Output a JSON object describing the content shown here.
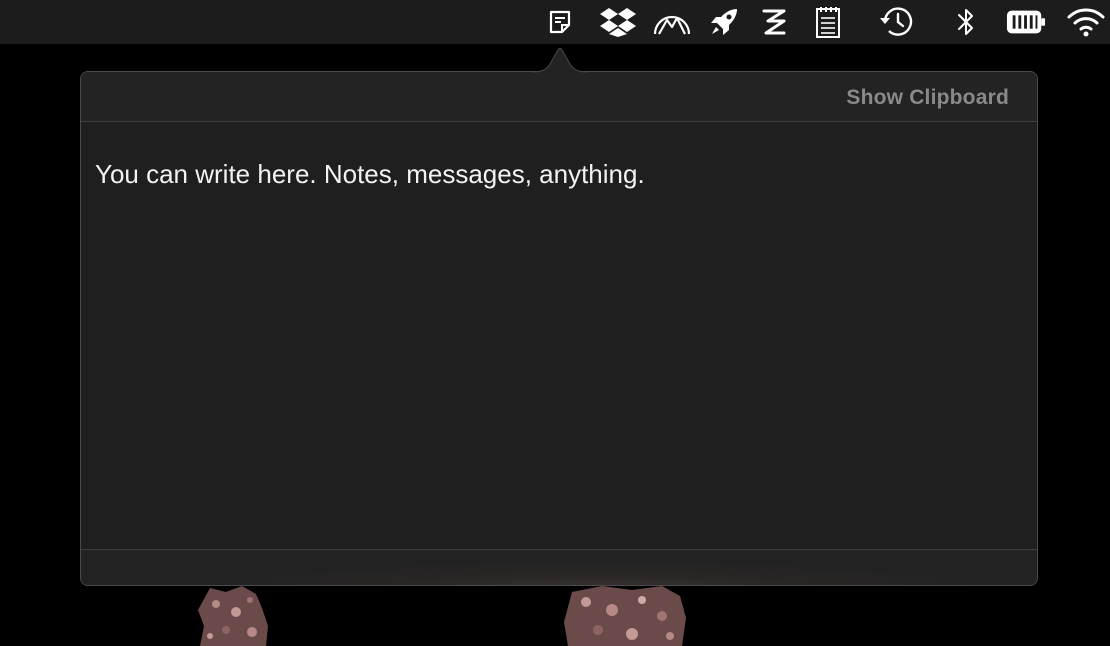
{
  "menubar": {
    "icons": [
      {
        "name": "note-icon"
      },
      {
        "name": "dropbox-icon"
      },
      {
        "name": "mountains-icon"
      },
      {
        "name": "rocket-icon"
      },
      {
        "name": "zap-icon"
      },
      {
        "name": "notepad-icon"
      },
      {
        "name": "time-machine-icon"
      },
      {
        "name": "bluetooth-icon"
      },
      {
        "name": "battery-icon"
      },
      {
        "name": "wifi-icon"
      }
    ]
  },
  "popover": {
    "show_clipboard_label": "Show Clipboard",
    "note_text": "You can write here. Notes, messages, anything."
  },
  "colors": {
    "menubar_bg": "#1c1c1c",
    "popover_bg": "#202020",
    "text": "#f2f2f2",
    "muted_text": "#8a8a8a"
  }
}
